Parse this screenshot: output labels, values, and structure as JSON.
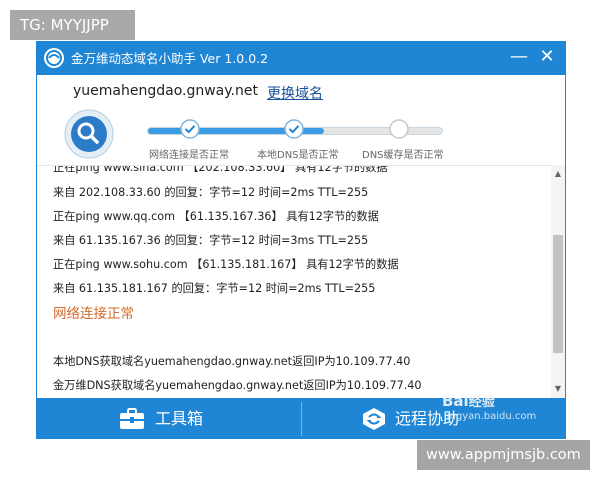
{
  "overlays": {
    "tg_label": "TG: MYYJJPP",
    "footer_label": "www.appmjmsjb.com",
    "watermark_baidu": "Bai",
    "watermark_baidu_suffix": "经验",
    "watermark_url": "jingyan.baidu.com"
  },
  "window": {
    "title": "金万维动态域名小助手 Ver 1.0.0.2",
    "minimize_symbol": "—",
    "close_symbol": "✕"
  },
  "header": {
    "domain": "yuemahengdao.gnway.net",
    "change_domain_label": "更换域名"
  },
  "progress": {
    "completed_steps": 2,
    "total_steps": 3,
    "steps": [
      {
        "label": "网络连接是否正常",
        "done": true
      },
      {
        "label": "本地DNS是否正常",
        "done": true
      },
      {
        "label": "DNS缓存是否正常",
        "done": false
      }
    ]
  },
  "log": {
    "lines": [
      "正在ping www.sina.com 【202.108.33.60】 具有12字节的数据",
      "来自 202.108.33.60 的回复：字节=12 时间=2ms TTL=255",
      "正在ping www.qq.com 【61.135.167.36】 具有12字节的数据",
      "来自 61.135.167.36 的回复：字节=12 时间=3ms TTL=255",
      "正在ping www.sohu.com 【61.135.181.167】 具有12字节的数据",
      "来自 61.135.181.167 的回复：字节=12 时间=2ms TTL=255"
    ],
    "status": "网络连接正常",
    "dns_local": "本地DNS获取域名yuemahengdao.gnway.net返回IP为10.109.77.40",
    "dns_gnway": "金万维DNS获取域名yuemahengdao.gnway.net返回IP为10.109.77.40"
  },
  "bottom": {
    "toolbox_label": "工具箱",
    "remote_label": "远程协助"
  },
  "colors": {
    "primary": "#1f86d6",
    "status_text": "#d46a2a",
    "link": "#1a4f9c"
  }
}
